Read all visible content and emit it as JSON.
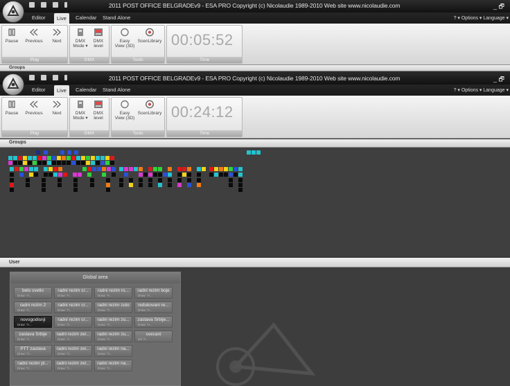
{
  "window": {
    "title": "2011 POST OFFICE BELGRADEv9 - ESA PRO   Copyright (c) Nicolaudie 1989-2010   Web site www.nicolaudie.com",
    "controls": "_ 🗗",
    "right_menu": "? ▾ Options ▾ Language ▾"
  },
  "tabs": [
    "Editor",
    "Live",
    "Calendar",
    "Stand Alone"
  ],
  "ribbon": {
    "play": {
      "caption": "Play",
      "pause": "Pause",
      "previous": "Previous",
      "next": "Next"
    },
    "dmx": {
      "caption": "DMX",
      "mode": "DMX Mode ▾",
      "level": "DMX level"
    },
    "tools": {
      "caption": "Tools",
      "easy_view": "Easy View (3D)",
      "scenlibrary": "ScenLibrary"
    },
    "time": {
      "caption": "Time"
    }
  },
  "window1": {
    "timer": "00:05:52"
  },
  "window2": {
    "timer": "00:24:12"
  },
  "panels": {
    "groups": "Groups",
    "user": "User"
  },
  "global_area": {
    "title": "Global area",
    "buttons": [
      {
        "label": "belo svetlo",
        "sub": "Draw: ?!..."
      },
      {
        "label": "radni rezim cr...",
        "sub": "Draw: ?!..."
      },
      {
        "label": "radni rezim ro...",
        "sub": "Draw: ?!..."
      },
      {
        "label": "radni rezim boje",
        "sub": "Draw: ?!..."
      },
      {
        "label": "radni rezim 2",
        "sub": "Draw: ?!..."
      },
      {
        "label": "radni rezim cr...",
        "sub": "Draw: ?!..."
      },
      {
        "label": "radni rezim zuto",
        "sub": "Draw: ?!..."
      },
      {
        "label": "redukovani re...",
        "sub": "Draw: ?!..."
      },
      {
        "label": "novogodisnji",
        "sub": "Draw: ?!..."
      },
      {
        "label": "radni rezim cr...",
        "sub": "Draw: ?!..."
      },
      {
        "label": "radni rezim zu...",
        "sub": "Draw: ?!..."
      },
      {
        "label": "zastava Srbije...",
        "sub": "Draw: ?!..."
      },
      {
        "label": "zastava Srbije",
        "sub": "Draw: ?!..."
      },
      {
        "label": "radni rezim zel...",
        "sub": "Draw: ?!..."
      },
      {
        "label": "radni rezim zu...",
        "sub": "Draw: ?!..."
      },
      {
        "label": "svecani",
        "sub": "3/4 ?!..."
      },
      {
        "label": "PTT zastava",
        "sub": "Draw: ?!..."
      },
      {
        "label": "radni rezim zel...",
        "sub": "Draw: ?!..."
      },
      {
        "label": "radni rezim na...",
        "sub": "Draw: ?!..."
      },
      {
        "label": "radni rezim pl...",
        "sub": "Draw: ?!..."
      },
      {
        "label": "radni rezim zel...",
        "sub": "Draw: ?!..."
      },
      {
        "label": "radni rezim na...",
        "sub": "Draw: ?!..."
      }
    ]
  },
  "colors": {
    "black": "#0b0b0b",
    "red": "#e01818",
    "yellow": "#f2d21a",
    "blue": "#2a52d8",
    "cyan": "#22c4cf",
    "green": "#2fd23c",
    "orange": "#f07a16",
    "magenta": "#d83ad2",
    "darkblue": "#1c2c88"
  },
  "fixture_palette": "Ky",
  "fixture_rows": [
    "...B....b..B..B.......................................................c..c..c",
    "KKKKKKKKKKKKKKKKKKKKKKKKKKKKKKKKKKKKKKKK",
    "KKKKKKKKKKKKKKKKKKKKKKKKKKKKKKKKKKKKKKKK"
  ]
}
